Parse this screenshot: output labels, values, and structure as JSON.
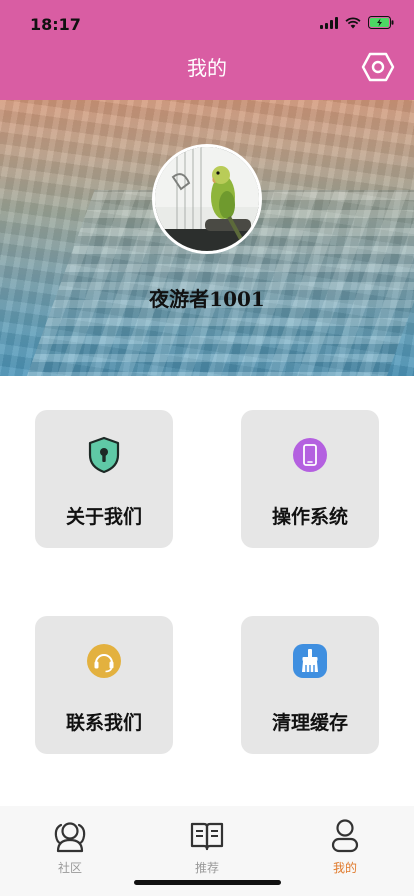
{
  "status_bar": {
    "time": "18:17"
  },
  "nav": {
    "title": "我的",
    "settings_icon": "settings-hexagon-icon"
  },
  "profile": {
    "username": "夜游者1001",
    "avatar_icon": "parrot-avatar"
  },
  "menu": [
    {
      "label": "关于我们",
      "icon": "shield-keyhole-icon",
      "icon_color": "#5fc9a6"
    },
    {
      "label": "操作系统",
      "icon": "phone-icon",
      "icon_color": "#b460e0"
    },
    {
      "label": "联系我们",
      "icon": "headset-icon",
      "icon_color": "#e3b13f"
    },
    {
      "label": "清理缓存",
      "icon": "broom-icon",
      "icon_color": "#3f8fe0"
    }
  ],
  "tabbar": {
    "items": [
      {
        "label": "社区",
        "icon": "community-icon",
        "active": false
      },
      {
        "label": "推荐",
        "icon": "book-icon",
        "active": false
      },
      {
        "label": "我的",
        "icon": "user-icon",
        "active": true
      }
    ],
    "active_color": "#e07a2c"
  },
  "colors": {
    "topbar": "#d95da3",
    "card": "#e6e6e6"
  }
}
